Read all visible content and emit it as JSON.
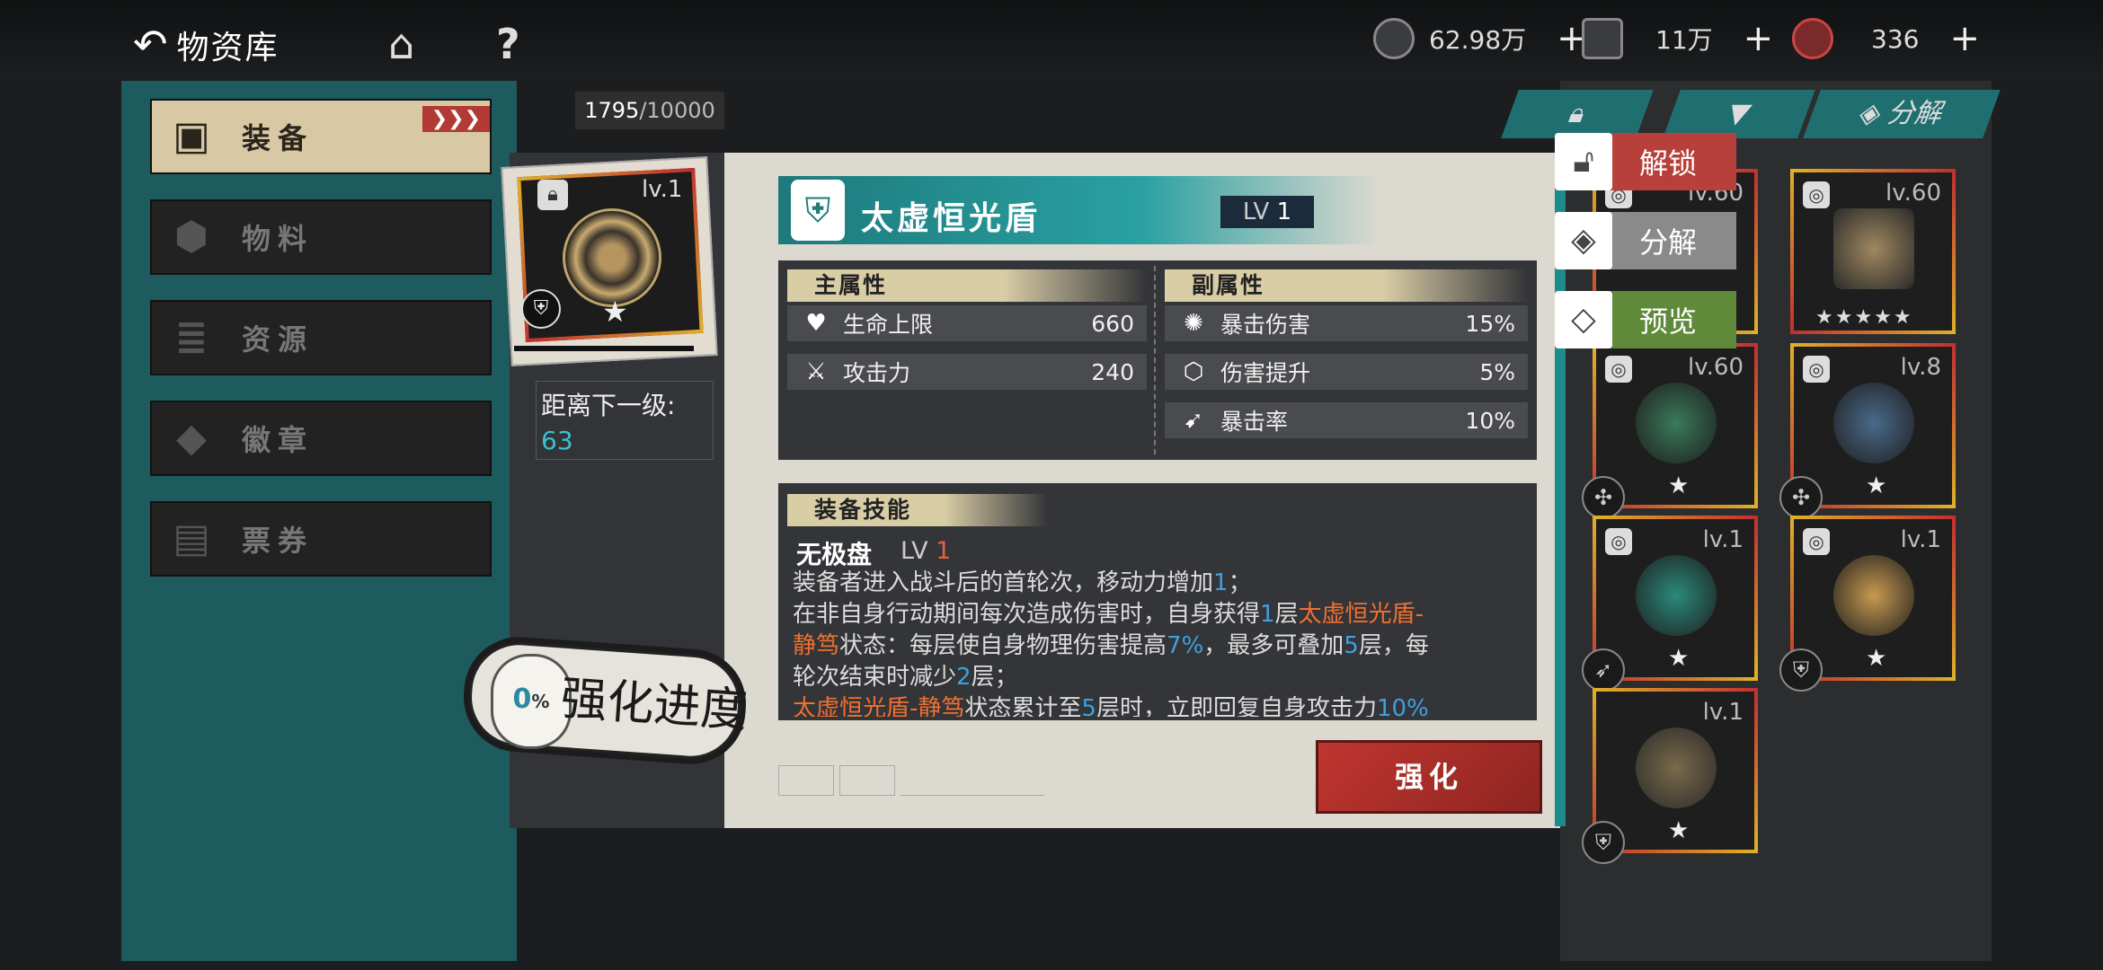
{
  "topbar": {
    "title": "物资库",
    "resources": [
      {
        "icon": "coin-icon",
        "value": "62.98万"
      },
      {
        "icon": "box-icon",
        "value": "11万"
      },
      {
        "icon": "gem-icon",
        "value": "336"
      }
    ],
    "plus": "+"
  },
  "sidebar": {
    "items": [
      {
        "label": "装备",
        "icon": "equipment-icon",
        "selected": true,
        "arrows": "❯❯❯"
      },
      {
        "label": "物料",
        "icon": "materials-icon"
      },
      {
        "label": "资源",
        "icon": "resources-icon"
      },
      {
        "label": "徽章",
        "icon": "badge-icon"
      },
      {
        "label": "票券",
        "icon": "ticket-icon"
      }
    ]
  },
  "capacity": {
    "current": "1795",
    "max": "/10000"
  },
  "selected_item": {
    "level": "lv.1",
    "next_level_label": "距离下一级:",
    "next_level_value": "63"
  },
  "progress": {
    "percent": "0",
    "pct_sign": "%",
    "label": "强化进度"
  },
  "detail": {
    "name": "太虚恒光盾",
    "lv_label": "LV",
    "lv_value": "1",
    "main_header": "主属性",
    "sub_header": "副属性",
    "main_stats": [
      {
        "icon": "heart-shield-icon",
        "name": "生命上限",
        "value": "660"
      },
      {
        "icon": "swords-icon",
        "name": "攻击力",
        "value": "240"
      }
    ],
    "sub_stats": [
      {
        "icon": "crit-damage-icon",
        "name": "暴击伤害",
        "value": "15%"
      },
      {
        "icon": "damage-up-icon",
        "name": "伤害提升",
        "value": "5%"
      },
      {
        "icon": "crit-rate-icon",
        "name": "暴击率",
        "value": "10%"
      }
    ],
    "skill_header": "装备技能",
    "skill_name": "无极盘",
    "skill_lv_label": "LV",
    "skill_lv_value": "1",
    "desc": {
      "l1a": "装备者进入战斗后的首轮次，移动力增加",
      "l1b": "1",
      "l1c": "；",
      "l2a": "在非自身行动期间每次造成伤害时，自身获得",
      "l2b": "1",
      "l2c": "层",
      "l2d": "太虚恒光盾-",
      "l3a": "静笃",
      "l3b": "状态：每层使自身物理伤害提高",
      "l3c": "7%",
      "l3d": "，最多可叠加",
      "l3e": "5",
      "l3f": "层，每",
      "l4a": "轮次结束时减少",
      "l4b": "2",
      "l4c": "层；",
      "l5a": "太虚恒光盾-静笃",
      "l5b": "状态累计至",
      "l5c": "5",
      "l5d": "层时，立即回复自身攻击力",
      "l5e": "10%"
    },
    "strengthen_button": "强化"
  },
  "side_actions": [
    {
      "label": "解锁",
      "icon": "unlock-icon",
      "color": "#b8403a"
    },
    {
      "label": "分解",
      "icon": "decompose-icon",
      "color": "#8a8a8a"
    },
    {
      "label": "预览",
      "icon": "preview-icon",
      "color": "#5e8a3a"
    }
  ],
  "tabs": {
    "decompose": "分解"
  },
  "grid": [
    {
      "level": "lv.60"
    },
    {
      "level": "lv.60"
    },
    {
      "level": "lv.60"
    },
    {
      "level": "lv.8"
    },
    {
      "level": "lv.1"
    },
    {
      "level": "lv.1"
    },
    {
      "level": "lv.1"
    }
  ]
}
